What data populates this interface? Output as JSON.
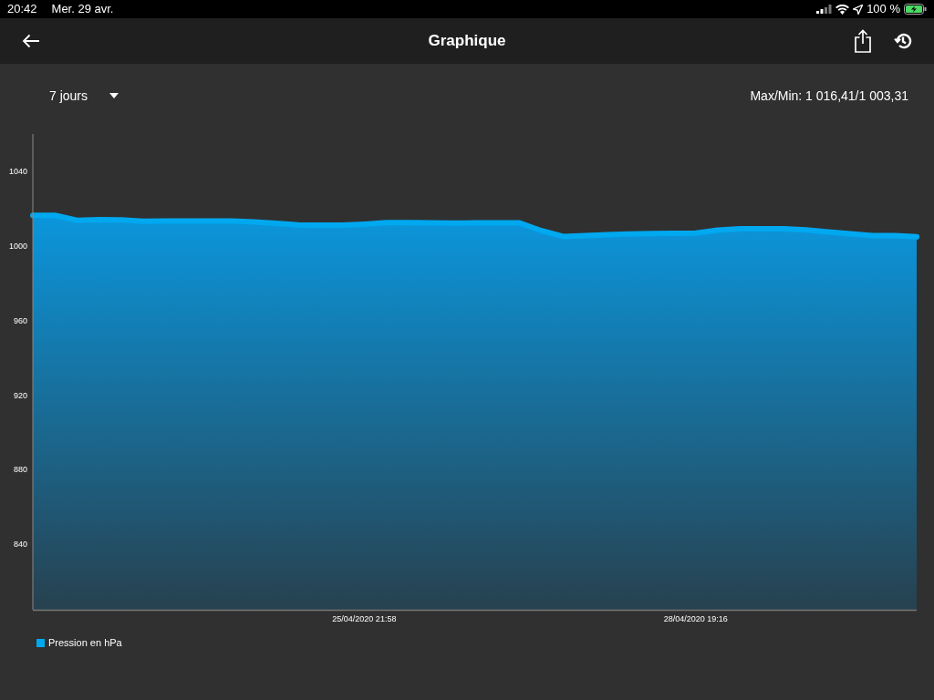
{
  "status_bar": {
    "time": "20:42",
    "date": "Mer. 29 avr.",
    "battery": "100 %"
  },
  "header": {
    "title": "Graphique"
  },
  "controls": {
    "period": "7 jours",
    "max_min": "Max/Min: 1 016,41/1 003,31"
  },
  "chart": {
    "chart_data": {
      "type": "area",
      "ylim": [
        805,
        1060
      ],
      "yticks": [
        840,
        880,
        920,
        960,
        1000,
        1040
      ],
      "categories": [
        null,
        null,
        null,
        null,
        null,
        null,
        null,
        null,
        null,
        null,
        null,
        null,
        null,
        null,
        null,
        "25/04/2020 21:58",
        null,
        null,
        null,
        null,
        null,
        null,
        null,
        null,
        null,
        null,
        null,
        null,
        null,
        null,
        "28/04/2020 19:16",
        null,
        null,
        null,
        null,
        null,
        null,
        null,
        null,
        null,
        null
      ],
      "series": [
        {
          "name": "Pression en hPa",
          "color": "#00a8f0",
          "values": [
            1016.4,
            1016.4,
            1013.7,
            1014.1,
            1014.0,
            1013.2,
            1013.3,
            1013.3,
            1013.4,
            1013.4,
            1012.8,
            1012.1,
            1011.3,
            1011.2,
            1011.1,
            1011.7,
            1012.5,
            1012.5,
            1012.4,
            1012.2,
            1012.3,
            1012.3,
            1012.4,
            1008.2,
            1005.1,
            1005.6,
            1006.0,
            1006.4,
            1006.6,
            1006.7,
            1006.9,
            1008.4,
            1009.2,
            1009.2,
            1009.2,
            1008.6,
            1007.5,
            1006.5,
            1005.6,
            1005.5,
            1004.9
          ]
        }
      ]
    }
  }
}
